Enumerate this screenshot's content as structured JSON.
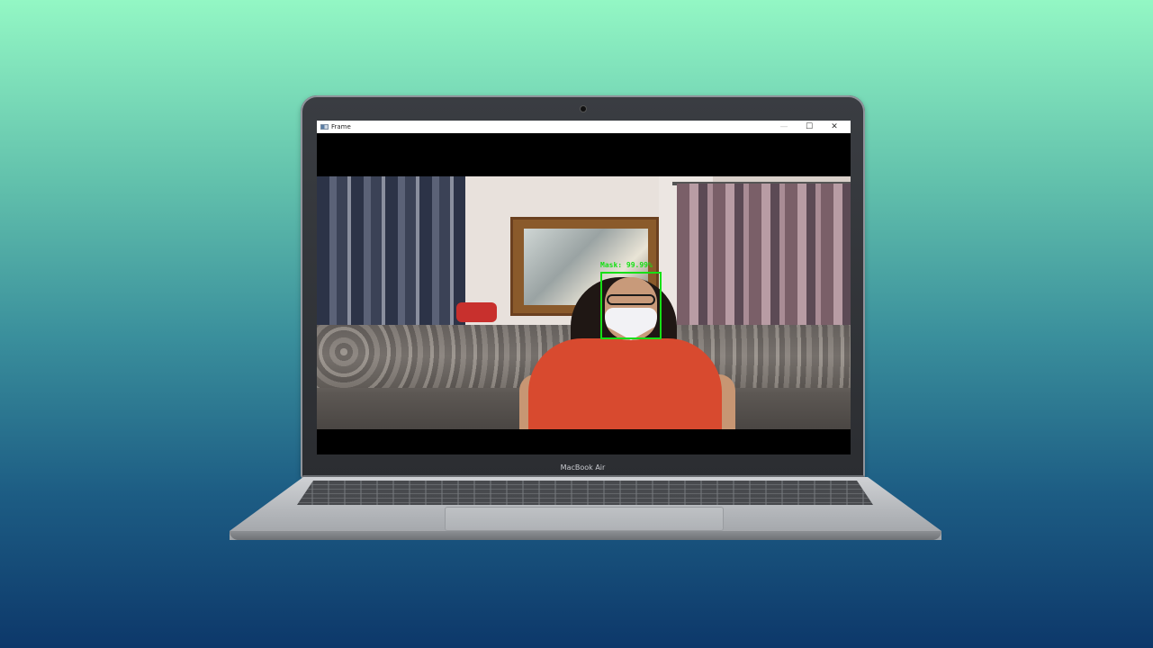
{
  "window": {
    "title": "Frame",
    "minimize_icon": "minimize-icon",
    "maximize_icon": "maximize-icon",
    "close_icon": "close-icon",
    "maximize_glyph": "☐",
    "close_glyph": "✕",
    "minimize_glyph": "—"
  },
  "video": {
    "detection_label": "Mask: 99.99%",
    "detection_color": "#16e016"
  },
  "device": {
    "brand_label": "MacBook Air"
  }
}
